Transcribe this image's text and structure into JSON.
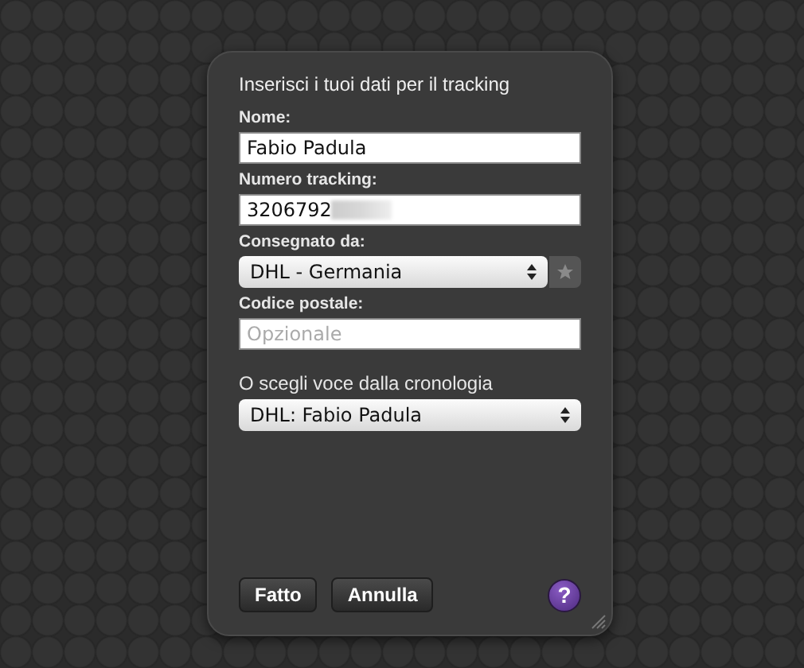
{
  "title": "Inserisci i tuoi dati per il tracking",
  "fields": [
    {
      "kind": "text",
      "label": "Nome:",
      "value": "Fabio Padula"
    },
    {
      "kind": "redacted",
      "label": "Numero tracking:",
      "value": "3206792"
    },
    {
      "kind": "select",
      "label": "Consegnato da:",
      "value": "DHL - Germania"
    },
    {
      "kind": "text",
      "label": "Codice postale:",
      "placeholder": "Opzionale"
    }
  ],
  "history": {
    "label": "O scegli voce dalla cronologia",
    "value": "DHL: Fabio Padula"
  },
  "buttons": [
    "Fatto",
    "Annulla"
  ],
  "help": "?"
}
